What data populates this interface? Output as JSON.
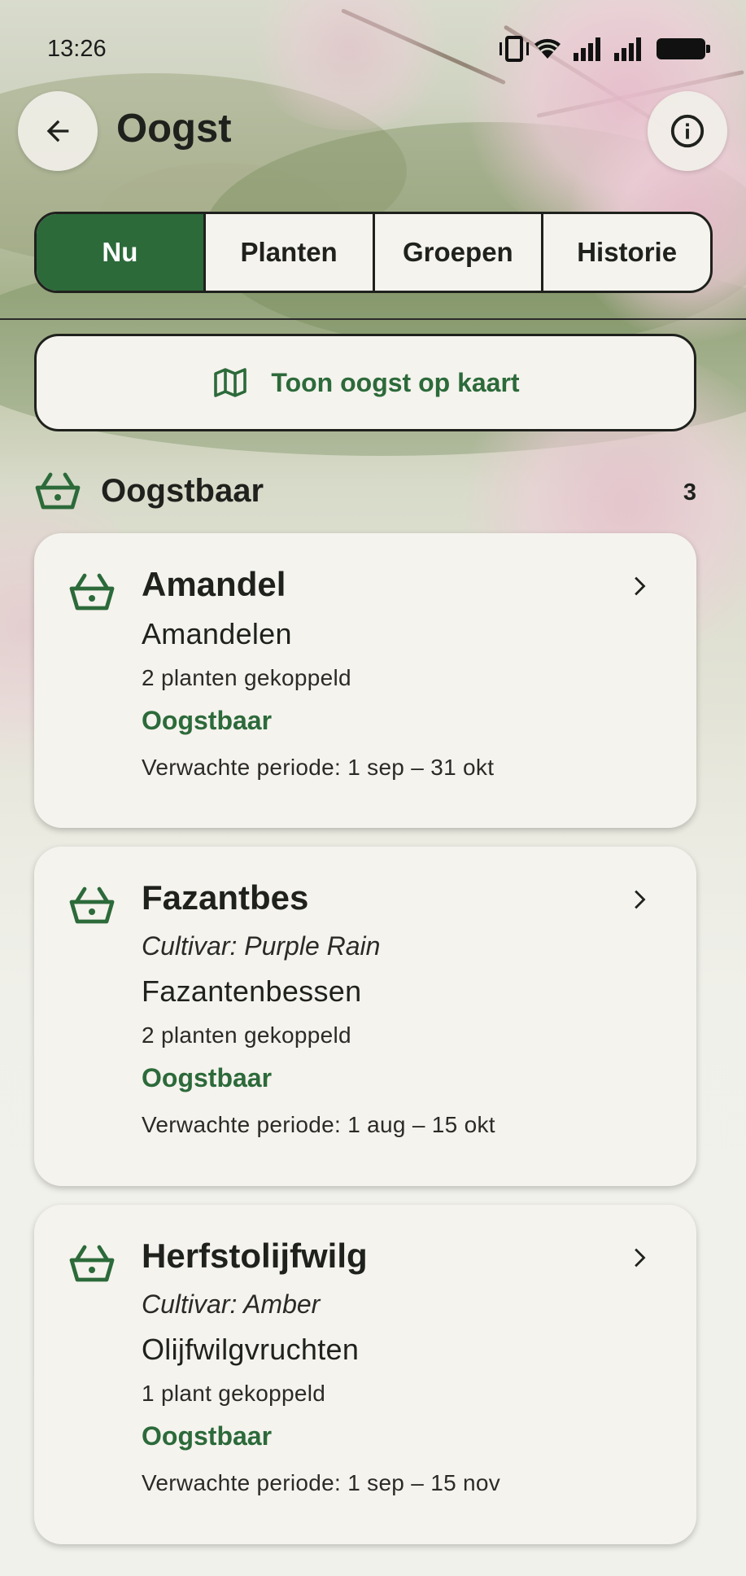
{
  "status_bar": {
    "time": "13:26",
    "icons": [
      "vibrate-icon",
      "wifi-icon",
      "signal-icon",
      "signal-icon",
      "battery-icon"
    ]
  },
  "app_bar": {
    "title": "Oogst",
    "back_icon": "arrow-left-icon",
    "info_icon": "info-icon"
  },
  "tabs": [
    {
      "label": "Nu",
      "active": true
    },
    {
      "label": "Planten",
      "active": false
    },
    {
      "label": "Groepen",
      "active": false
    },
    {
      "label": "Historie",
      "active": false
    }
  ],
  "map_button": {
    "label": "Toon oogst op kaart",
    "icon": "map-icon"
  },
  "section": {
    "title": "Oogstbaar",
    "count": "3",
    "icon": "basket-icon"
  },
  "cards": [
    {
      "title": "Amandel",
      "cultivar": "",
      "product": "Amandelen",
      "plants": "2 planten gekoppeld",
      "status": "Oogstbaar",
      "period": "Verwachte periode: 1 sep – 31 okt"
    },
    {
      "title": "Fazantbes",
      "cultivar": "Cultivar: Purple Rain",
      "product": "Fazantenbessen",
      "plants": "2 planten gekoppeld",
      "status": "Oogstbaar",
      "period": "Verwachte periode: 1 aug – 15 okt"
    },
    {
      "title": "Herfstolijfwilg",
      "cultivar": "Cultivar: Amber",
      "product": "Olijfwilgvruchten",
      "plants": "1 plant gekoppeld",
      "status": "Oogstbaar",
      "period": "Verwachte periode: 1 sep – 15 nov"
    }
  ],
  "colors": {
    "accent_green": "#2c6a3a",
    "surface": "#f5f3ee",
    "text": "#1f211d"
  }
}
